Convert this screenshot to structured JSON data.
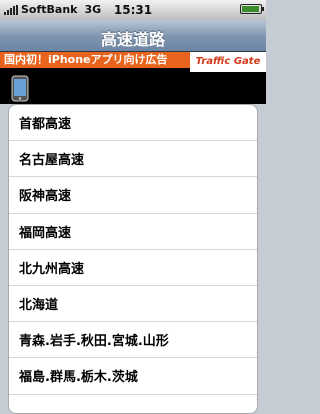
{
  "status_bar": {
    "carrier": "SoftBank",
    "network": "3G",
    "time": "15:31"
  },
  "nav": {
    "title": "高速道路"
  },
  "ad": {
    "headline": "国内初！iPhoneアプリ向け広告",
    "logo": "Traffic Gate"
  },
  "list": {
    "items": [
      "首都高速",
      "名古屋高速",
      "阪神高速",
      "福岡高速",
      "北九州高速",
      "北海道",
      "青森.岩手.秋田.宮城.山形",
      "福島.群馬.栃木.茨城"
    ]
  }
}
